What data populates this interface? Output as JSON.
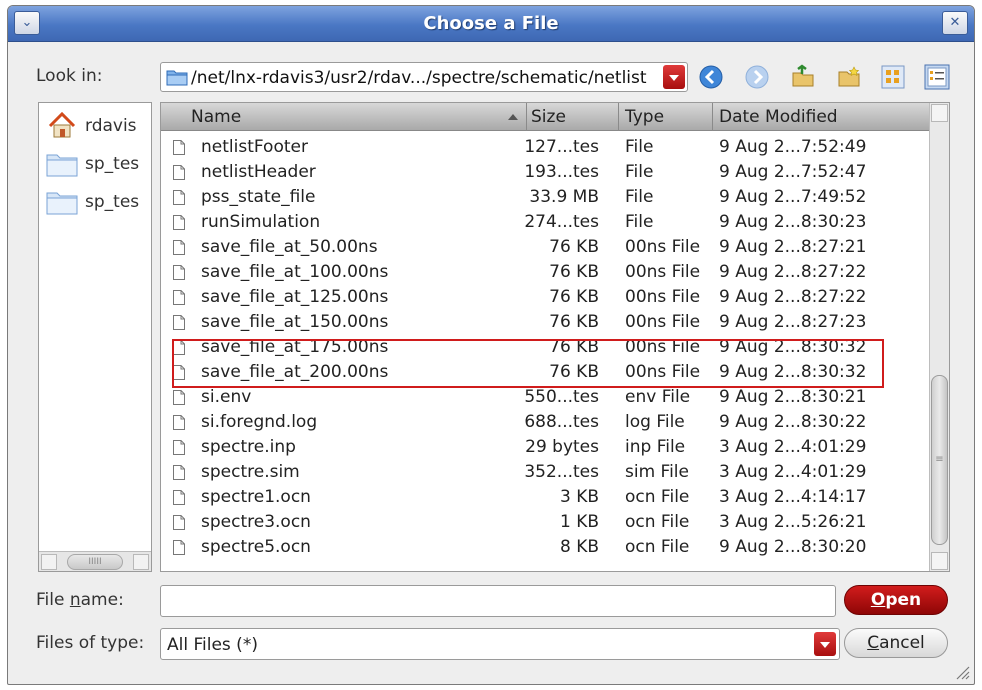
{
  "window": {
    "title": "Choose a File",
    "title_bg": "#4a77c4",
    "accent_red": "#d01c1c"
  },
  "titlebar": {
    "menu_icon": "chevron-down-icon",
    "close_icon": "close-icon",
    "menu_glyph": "⌄",
    "close_glyph": "✕"
  },
  "lookin": {
    "label": "Look in:",
    "path": "/net/lnx-rdavis3/usr2/rdav.../spectre/schematic/netlist"
  },
  "toolbar": {
    "icons": [
      "back-icon",
      "forward-icon",
      "parent-folder-icon",
      "new-folder-icon",
      "icon-view-icon",
      "detail-view-icon"
    ]
  },
  "places": [
    {
      "name": "rdavis",
      "icon": "home-icon"
    },
    {
      "name": "sp_tes",
      "icon": "folder-icon"
    },
    {
      "name": "sp_tes",
      "icon": "folder-icon"
    }
  ],
  "places_scroll": {
    "thumb_label": "IIIII"
  },
  "columns": {
    "name": "Name",
    "size": "Size",
    "type": "Type",
    "date": "Date Modified"
  },
  "files": [
    {
      "name": "netlistFooter",
      "size": "127...tes",
      "type": "File",
      "date": "9 Aug 2...7:52:49"
    },
    {
      "name": "netlistHeader",
      "size": "193...tes",
      "type": "File",
      "date": "9 Aug 2...7:52:47"
    },
    {
      "name": "pss_state_file",
      "size": "33.9 MB",
      "type": "File",
      "date": "9 Aug 2...7:49:52"
    },
    {
      "name": "runSimulation",
      "size": "274...tes",
      "type": "File",
      "date": "9 Aug 2...8:30:23"
    },
    {
      "name": "save_file_at_50.00ns",
      "size": "76 KB",
      "type": "00ns File",
      "date": "9 Aug 2...8:27:21"
    },
    {
      "name": "save_file_at_100.00ns",
      "size": "76 KB",
      "type": "00ns File",
      "date": "9 Aug 2...8:27:22"
    },
    {
      "name": "save_file_at_125.00ns",
      "size": "76 KB",
      "type": "00ns File",
      "date": "9 Aug 2...8:27:22"
    },
    {
      "name": "save_file_at_150.00ns",
      "size": "76 KB",
      "type": "00ns File",
      "date": "9 Aug 2...8:27:23"
    },
    {
      "name": "save_file_at_175.00ns",
      "size": "76 KB",
      "type": "00ns File",
      "date": "9 Aug 2...8:30:32"
    },
    {
      "name": "save_file_at_200.00ns",
      "size": "76 KB",
      "type": "00ns File",
      "date": "9 Aug 2...8:30:32"
    },
    {
      "name": "si.env",
      "size": "550...tes",
      "type": "env File",
      "date": "9 Aug 2...8:30:21"
    },
    {
      "name": "si.foregnd.log",
      "size": "688...tes",
      "type": "log File",
      "date": "9 Aug 2...8:30:22"
    },
    {
      "name": "spectre.inp",
      "size": "29 bytes",
      "type": "inp File",
      "date": "3 Aug 2...4:01:29"
    },
    {
      "name": "spectre.sim",
      "size": "352...tes",
      "type": "sim File",
      "date": "3 Aug 2...4:01:29"
    },
    {
      "name": "spectre1.ocn",
      "size": "3 KB",
      "type": "ocn File",
      "date": "3 Aug 2...4:14:17"
    },
    {
      "name": "spectre3.ocn",
      "size": "1 KB",
      "type": "ocn File",
      "date": "3 Aug 2...5:26:21"
    },
    {
      "name": "spectre5.ocn",
      "size": "8 KB",
      "type": "ocn File",
      "date": "9 Aug 2...8:30:20"
    }
  ],
  "file_scroll": {
    "thumb_label": "≡"
  },
  "filename": {
    "label_pre": "File ",
    "label_accel": "n",
    "label_post": "ame:",
    "value": ""
  },
  "filetype": {
    "label": "Files of type:",
    "value": "All Files (*)"
  },
  "buttons": {
    "open_accel": "O",
    "open_rest": "pen",
    "cancel_accel": "C",
    "cancel_rest": "ancel"
  }
}
